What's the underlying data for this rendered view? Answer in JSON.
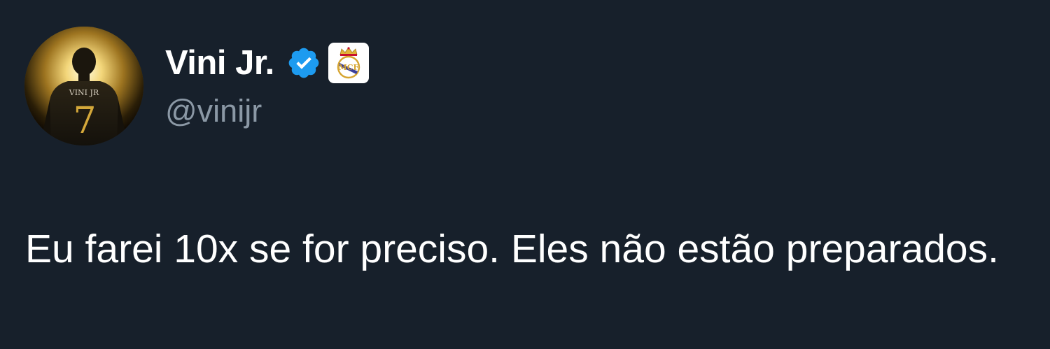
{
  "author": {
    "display_name": "Vini Jr.",
    "handle": "@vinijr",
    "avatar_jersey_text": "VINI JR",
    "avatar_jersey_number": "7",
    "verified_icon": "verified-check-icon",
    "affiliation_icon": "real-madrid-crest-icon"
  },
  "tweet": {
    "text": "Eu farei 10x se for preciso. Eles não estão preparados."
  },
  "colors": {
    "background": "#17202b",
    "text_primary": "#ffffff",
    "text_secondary": "#8b98a5",
    "verified_blue": "#1d9bf0",
    "avatar_gold": "#d4a83a"
  }
}
